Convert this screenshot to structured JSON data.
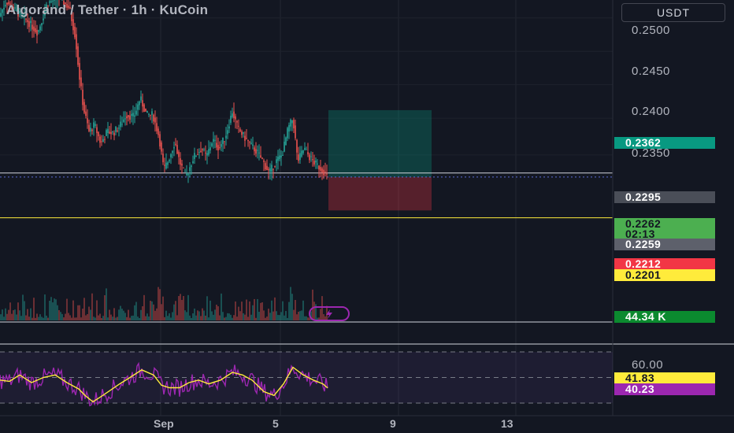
{
  "header": {
    "title": "Algorand / Tether · 1h · KuCoin",
    "currency_button": "USDT"
  },
  "price_axis": {
    "ticks": [
      {
        "label": "0.2500",
        "value": 0.25
      },
      {
        "label": "0.2450",
        "value": 0.245
      },
      {
        "label": "0.2400",
        "value": 0.24
      },
      {
        "label": "0.2350",
        "value": 0.235
      }
    ],
    "tags": {
      "target": {
        "label": "0.2362",
        "bg": "#089981",
        "fg": "#ffffff"
      },
      "high_line": {
        "label": "0.2295",
        "bg": "#4a4e58",
        "fg": "#ffffff"
      },
      "last_price": {
        "label": "0.2262",
        "bg": "#4caf50",
        "fg": "#131722"
      },
      "countdown": {
        "label": "02:13",
        "bg": "#4caf50",
        "fg": "#131722"
      },
      "bid": {
        "label": "0.2259",
        "bg": "#5d606b",
        "fg": "#ffffff"
      },
      "stop": {
        "label": "0.2212",
        "bg": "#f23645",
        "fg": "#ffffff"
      },
      "support": {
        "label": "0.2201",
        "bg": "#ffeb3b",
        "fg": "#131722"
      },
      "volume": {
        "label": "44.34 K",
        "bg": "#0b8a2f",
        "fg": "#ffffff"
      }
    }
  },
  "rsi_axis": {
    "level": {
      "label": "60.00"
    },
    "tags": {
      "rsi_ma": {
        "label": "41.83",
        "bg": "#ffeb3b",
        "fg": "#131722"
      },
      "rsi": {
        "label": "40.23",
        "bg": "#9c27b0",
        "fg": "#ffffff"
      }
    }
  },
  "time_axis": {
    "labels": [
      "Sep",
      "5",
      "9",
      "13"
    ]
  },
  "colors": {
    "up": "#26a69a",
    "down": "#ef5350",
    "rsi": "#9c27b0",
    "rsi_ma": "#ffeb3b",
    "bolt": "#9c27b0"
  },
  "chart_data": {
    "type": "candlestick",
    "y_range": [
      0.219,
      0.2515
    ],
    "position": {
      "side": "long",
      "entry": 0.2262,
      "target": 0.2362,
      "stop": 0.2212
    },
    "levels": {
      "upper_line": 0.2268,
      "support_line": 0.2201,
      "last_price": 0.2262
    },
    "price_path": [
      [
        0,
        0.2505
      ],
      [
        8,
        0.2525
      ],
      [
        20,
        0.251
      ],
      [
        35,
        0.2495
      ],
      [
        48,
        0.2478
      ],
      [
        60,
        0.2522
      ],
      [
        75,
        0.253
      ],
      [
        88,
        0.2515
      ],
      [
        96,
        0.247
      ],
      [
        100,
        0.242
      ],
      [
        106,
        0.2365
      ],
      [
        113,
        0.233
      ],
      [
        120,
        0.234
      ],
      [
        128,
        0.2312
      ],
      [
        136,
        0.233
      ],
      [
        144,
        0.2328
      ],
      [
        152,
        0.2338
      ],
      [
        160,
        0.2355
      ],
      [
        170,
        0.2352
      ],
      [
        178,
        0.238
      ],
      [
        186,
        0.2355
      ],
      [
        194,
        0.2355
      ],
      [
        202,
        0.2322
      ],
      [
        208,
        0.2272
      ],
      [
        214,
        0.2288
      ],
      [
        222,
        0.2315
      ],
      [
        228,
        0.2285
      ],
      [
        236,
        0.2262
      ],
      [
        246,
        0.2292
      ],
      [
        256,
        0.2305
      ],
      [
        262,
        0.2292
      ],
      [
        270,
        0.2318
      ],
      [
        278,
        0.2305
      ],
      [
        286,
        0.2322
      ],
      [
        295,
        0.236
      ],
      [
        302,
        0.2335
      ],
      [
        310,
        0.2322
      ],
      [
        318,
        0.231
      ],
      [
        326,
        0.23
      ],
      [
        334,
        0.2285
      ],
      [
        342,
        0.2268
      ],
      [
        350,
        0.2285
      ],
      [
        358,
        0.2295
      ],
      [
        366,
        0.2335
      ],
      [
        372,
        0.235
      ],
      [
        378,
        0.2285
      ],
      [
        386,
        0.2305
      ],
      [
        394,
        0.229
      ],
      [
        402,
        0.228
      ],
      [
        410,
        0.2272
      ],
      [
        416,
        0.2262
      ]
    ],
    "rsi_path": [
      [
        0,
        48
      ],
      [
        12,
        47
      ],
      [
        25,
        52
      ],
      [
        40,
        46
      ],
      [
        55,
        50
      ],
      [
        70,
        52
      ],
      [
        85,
        46
      ],
      [
        100,
        41
      ],
      [
        108,
        36
      ],
      [
        118,
        31
      ],
      [
        128,
        35
      ],
      [
        140,
        40
      ],
      [
        152,
        45
      ],
      [
        165,
        50
      ],
      [
        180,
        56
      ],
      [
        195,
        52
      ],
      [
        205,
        44
      ],
      [
        215,
        42
      ],
      [
        228,
        42
      ],
      [
        240,
        46
      ],
      [
        252,
        48
      ],
      [
        265,
        45
      ],
      [
        280,
        48
      ],
      [
        295,
        54
      ],
      [
        308,
        52
      ],
      [
        320,
        48
      ],
      [
        335,
        39
      ],
      [
        348,
        36
      ],
      [
        360,
        45
      ],
      [
        372,
        58
      ],
      [
        385,
        52
      ],
      [
        398,
        48
      ],
      [
        410,
        45
      ],
      [
        416,
        41.83
      ]
    ]
  }
}
